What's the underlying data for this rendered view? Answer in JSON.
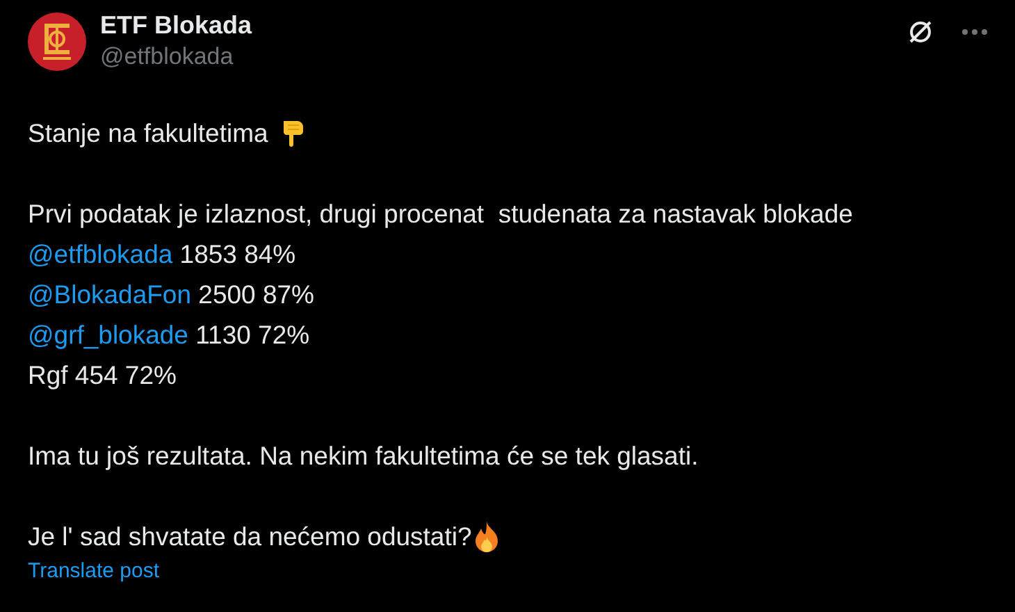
{
  "author": {
    "name": "ETF Blokada",
    "handle": "@etfblokada"
  },
  "post": {
    "paragraphs": [
      {
        "lines": [
          {
            "text": "Stanje na fakultetima",
            "kind": "hand"
          }
        ]
      },
      {
        "lines": [
          {
            "text": "Prvi podatak je izlaznost, drugi procenat  studenata za nastavak blokade"
          },
          {
            "mention": "@etfblokada",
            "text": " 1853 84%"
          },
          {
            "mention": "@BlokadaFon",
            "text": " 2500 87%"
          },
          {
            "mention": "@grf_blokade",
            "text": " 1130 72%"
          },
          {
            "text": "Rgf 454 72%"
          }
        ]
      },
      {
        "lines": [
          {
            "text": "Ima tu još rezultata. Na nekim fakultetima će se tek glasati."
          }
        ]
      },
      {
        "lines": [
          {
            "text": "Je l' sad shvatate da nećemo odustati?",
            "kind": "fire"
          }
        ]
      }
    ]
  },
  "translate_link": "Translate post"
}
